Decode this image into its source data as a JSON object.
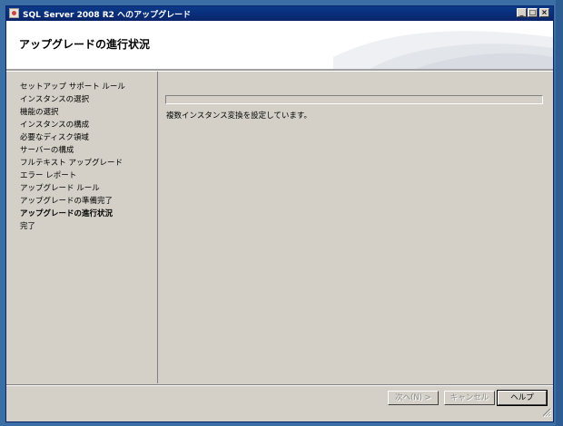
{
  "window": {
    "title": "SQL Server 2008 R2 へのアップグレード"
  },
  "header": {
    "title": "アップグレードの進行状況"
  },
  "sidebar": {
    "items": [
      {
        "label": "セットアップ サポート ルール",
        "current": false
      },
      {
        "label": "インスタンスの選択",
        "current": false
      },
      {
        "label": "機能の選択",
        "current": false
      },
      {
        "label": "インスタンスの構成",
        "current": false
      },
      {
        "label": "必要なディスク領域",
        "current": false
      },
      {
        "label": "サーバーの構成",
        "current": false
      },
      {
        "label": "フルテキスト アップグレード",
        "current": false
      },
      {
        "label": "エラー レポート",
        "current": false
      },
      {
        "label": "アップグレード ルール",
        "current": false
      },
      {
        "label": "アップグレードの準備完了",
        "current": false
      },
      {
        "label": "アップグレードの進行状況",
        "current": true
      },
      {
        "label": "完了",
        "current": false
      }
    ]
  },
  "main": {
    "progress_fraction": 0,
    "status": "複数インスタンス変換を設定しています。"
  },
  "footer": {
    "next_label": "次へ(N) >",
    "cancel_label": "キャンセル",
    "help_label": "ヘルプ"
  },
  "colors": {
    "desktop": "#3a6ea5",
    "titlebar": "#0a246a",
    "face": "#d4d0c8"
  }
}
